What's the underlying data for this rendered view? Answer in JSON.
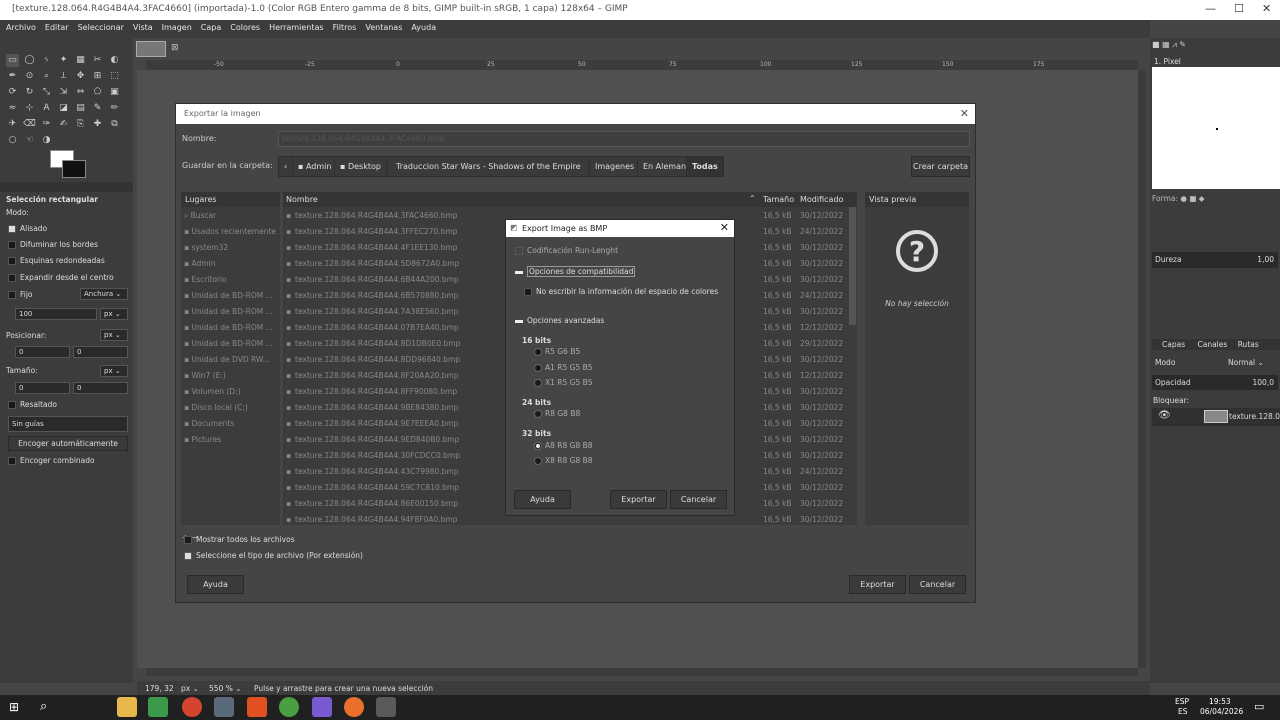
{
  "window": {
    "title": "[texture.128.064.R4G4B4A4.3FAC4660] (importada)-1.0 (Color RGB Entero gamma de 8 bits, GIMP built-in sRGB, 1 capa) 128x64 – GIMP"
  },
  "menu": [
    "Archivo",
    "Editar",
    "Seleccionar",
    "Vista",
    "Imagen",
    "Capa",
    "Colores",
    "Herramientas",
    "Filtros",
    "Ventanas",
    "Ayuda"
  ],
  "ruler": [
    "-50",
    "-25",
    "0",
    "25",
    "50",
    "75",
    "100",
    "125",
    "150",
    "175"
  ],
  "tool_options": {
    "title": "Selección rectangular",
    "mode_label": "Modo:",
    "antialias": "Alisado",
    "feather": "Difuminar los bordes",
    "rounded": "Esquinas redondeadas",
    "expand": "Expandir desde el centro",
    "fixed": "Fijo",
    "fixed_select": "Anchura",
    "fixed_value": "100",
    "unit": "px",
    "position_label": "Posicionar:",
    "pos_x": "0",
    "pos_y": "0",
    "size_label": "Tamaño:",
    "size_x": "0",
    "size_y": "0",
    "highlight": "Resaltado",
    "guides": "Sin guías",
    "autoshrink": "Encoger automáticamente",
    "shrink_merged": "Encoger combinado"
  },
  "right_dock": {
    "brush_name": "1. Pixel",
    "shape_label": "Forma:",
    "hardness_label": "Dureza",
    "hardness_value": "1,00",
    "tabs": [
      "Capas",
      "Canales",
      "Rutas"
    ],
    "mode_label": "Modo",
    "mode_value": "Normal",
    "opacity_label": "Opacidad",
    "opacity_value": "100,0",
    "lock_label": "Bloquear:",
    "layer_name": "texture.128.064"
  },
  "status": {
    "coords": "179, 32",
    "unit": "px",
    "zoom": "550 %",
    "message": "Pulse y arrastre para crear una nueva selección"
  },
  "export_dialog": {
    "title": "Exportar la imagen",
    "name_label": "Nombre:",
    "name_value": "texture.128.064.R4G4B4A4.3FAC4660.bmp",
    "folder_label": "Guardar en la carpeta:",
    "crumbs": [
      "Admin",
      "Desktop",
      "Traduccion Star Wars - Shadows of the Empire",
      "Imagenes",
      "En Aleman",
      "Todas"
    ],
    "create_folder": "Crear carpeta",
    "places_header": "Lugares",
    "places": [
      "Buscar",
      "Usados recientemente",
      "system32",
      "Admin",
      "Escritorio",
      "Unidad de BD-ROM ...",
      "Unidad de BD-ROM ...",
      "Unidad de BD-ROM ...",
      "Unidad de BD-ROM ...",
      "Unidad de DVD RW...",
      "Win7 (E:)",
      "Volumen (D:)",
      "Disco local (C:)",
      "Documents",
      "Pictures"
    ],
    "col_name": "Nombre",
    "col_size": "Tamaño",
    "col_modified": "Modificado",
    "files": [
      {
        "name": "texture.128.064.R4G4B4A4.3FAC4660.bmp",
        "size": "16,5 kB",
        "date": "30/12/2022"
      },
      {
        "name": "texture.128.064.R4G4B4A4.3FFEC270.bmp",
        "size": "16,5 kB",
        "date": "24/12/2022"
      },
      {
        "name": "texture.128.064.R4G4B4A4.4F1EE130.bmp",
        "size": "16,5 kB",
        "date": "30/12/2022"
      },
      {
        "name": "texture.128.064.R4G4B4A4.5D8672A0.bmp",
        "size": "16,5 kB",
        "date": "30/12/2022"
      },
      {
        "name": "texture.128.064.R4G4B4A4.6B44A200.bmp",
        "size": "16,5 kB",
        "date": "30/12/2022"
      },
      {
        "name": "texture.128.064.R4G4B4A4.6B570880.bmp",
        "size": "16,5 kB",
        "date": "24/12/2022"
      },
      {
        "name": "texture.128.064.R4G4B4A4.7A38E560.bmp",
        "size": "16,5 kB",
        "date": "30/12/2022"
      },
      {
        "name": "texture.128.064.R4G4B4A4.07B7EA40.bmp",
        "size": "16,5 kB",
        "date": "12/12/2022"
      },
      {
        "name": "texture.128.064.R4G4B4A4.8D1DB0E0.bmp",
        "size": "16,5 kB",
        "date": "29/12/2022"
      },
      {
        "name": "texture.128.064.R4G4B4A4.8DD96840.bmp",
        "size": "16,5 kB",
        "date": "30/12/2022"
      },
      {
        "name": "texture.128.064.R4G4B4A4.8F20AA20.bmp",
        "size": "16,5 kB",
        "date": "12/12/2022"
      },
      {
        "name": "texture.128.064.R4G4B4A4.8FF90080.bmp",
        "size": "16,5 kB",
        "date": "30/12/2022"
      },
      {
        "name": "texture.128.064.R4G4B4A4.9BE84380.bmp",
        "size": "16,5 kB",
        "date": "30/12/2022"
      },
      {
        "name": "texture.128.064.R4G4B4A4.9E7EEEA0.bmp",
        "size": "16,5 kB",
        "date": "30/12/2022"
      },
      {
        "name": "texture.128.064.R4G4B4A4.9ED840B0.bmp",
        "size": "16,5 kB",
        "date": "30/12/2022"
      },
      {
        "name": "texture.128.064.R4G4B4A4.30FCDCC0.bmp",
        "size": "16,5 kB",
        "date": "30/12/2022"
      },
      {
        "name": "texture.128.064.R4G4B4A4.43C79980.bmp",
        "size": "16,5 kB",
        "date": "24/12/2022"
      },
      {
        "name": "texture.128.064.R4G4B4A4.59C7C810.bmp",
        "size": "16,5 kB",
        "date": "30/12/2022"
      },
      {
        "name": "texture.128.064.R4G4B4A4.86E00150.bmp",
        "size": "16,5 kB",
        "date": "30/12/2022"
      },
      {
        "name": "texture.128.064.R4G4B4A4.94F8F0A0.bmp",
        "size": "16,5 kB",
        "date": "30/12/2022"
      }
    ],
    "preview_header": "Vista previa",
    "no_selection": "No hay selección",
    "show_all": "Mostrar todos los archivos",
    "file_type": "Seleccione el tipo de archivo (Por extensión)",
    "help": "Ayuda",
    "export": "Exportar",
    "cancel": "Cancelar"
  },
  "bmp_dialog": {
    "title": "Export Image as BMP",
    "rle": "Codificación Run-Lenght",
    "compat_header": "Opciones de compatibilidad",
    "no_colorspace": "No escribir la información del espacio de colores",
    "advanced_header": "Opciones avanzadas",
    "bits16": "16 bits",
    "r5g6b5": "R5 G6 B5",
    "a1r5g5b5": "A1 R5 G5 B5",
    "x1r5g5b5": "X1 R5 G5 B5",
    "bits24": "24 bits",
    "r8g8b8": "R8 G8 B8",
    "bits32": "32 bits",
    "a8r8g8b8": "A8 R8 G8 B8",
    "x8r8g8b8": "X8 R8 G8 B8",
    "help": "Ayuda",
    "export": "Exportar",
    "cancel": "Cancelar"
  },
  "taskbar": {
    "lang1": "ESP",
    "lang2": "ES",
    "time": "19:53",
    "date": "06/04/2026"
  }
}
